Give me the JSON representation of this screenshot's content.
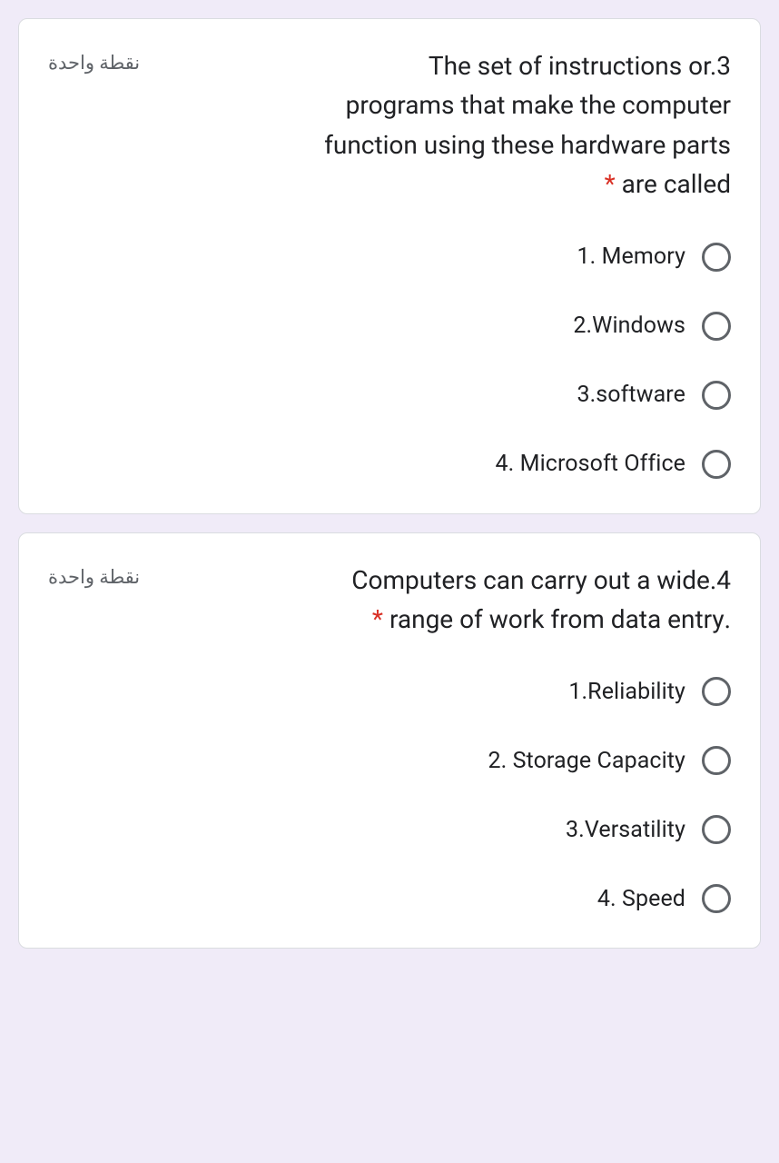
{
  "questions": [
    {
      "points": "نقطة واحدة",
      "text_line1": "The set of instructions or.3",
      "text_line2": "programs that make the computer",
      "text_line3": "function using these hardware parts",
      "text_line4": "are called",
      "required": "*",
      "options": [
        {
          "label": "1. Memory"
        },
        {
          "label": "2.Windows"
        },
        {
          "label": "3.software"
        },
        {
          "label": "4. Microsoft Office"
        }
      ]
    },
    {
      "points": "نقطة واحدة",
      "text_line1": "Computers can carry out a wide.4",
      "text_line2": ".range of work from data entry",
      "required": "*",
      "options": [
        {
          "label": "1.Reliability"
        },
        {
          "label": "2. Storage Capacity"
        },
        {
          "label": "3.Versatility"
        },
        {
          "label": "4. Speed"
        }
      ]
    }
  ]
}
